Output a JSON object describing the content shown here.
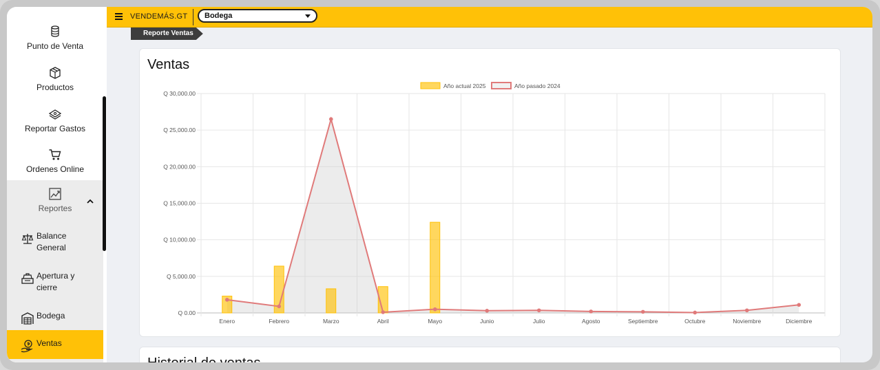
{
  "sidebar": {
    "top_items": [
      {
        "label": "Punto de Venta",
        "icon": "coins-icon"
      },
      {
        "label": "Productos",
        "icon": "box-icon"
      },
      {
        "label": "Reportar Gastos",
        "icon": "money-icon"
      },
      {
        "label": "Ordenes Online",
        "icon": "cart-icon"
      }
    ],
    "reportes_label": "Reportes",
    "sub_items": [
      {
        "label_1": "Balance",
        "label_2": "General",
        "icon": "balance-scale-icon"
      },
      {
        "label_1": "Apertura y",
        "label_2": "cierre",
        "icon": "cash-register-icon"
      },
      {
        "label_1": "Bodega",
        "label_2": "",
        "icon": "warehouse-icon"
      },
      {
        "label_1": "Ventas",
        "label_2": "",
        "icon": "hand-money-icon"
      }
    ],
    "active_color": "#ffc107"
  },
  "topbar": {
    "brand": "VENDEMÁS.GT",
    "store_selected": "Bodega"
  },
  "breadcrumb": "Reporte Ventas",
  "main": {
    "card_title": "Ventas",
    "second_card_title": "Historial de ventas"
  },
  "chart_data": {
    "type": "bar",
    "categories": [
      "Enero",
      "Febrero",
      "Marzo",
      "Abril",
      "Mayo",
      "Junio",
      "Julio",
      "Agosto",
      "Septiembre",
      "Octubre",
      "Noviembre",
      "Diciembre"
    ],
    "ylim": [
      0,
      30000
    ],
    "yticks": [
      "Q 0.00",
      "Q 5,000.00",
      "Q 10,000.00",
      "Q 15,000.00",
      "Q 20,000.00",
      "Q 25,000.00",
      "Q 30,000.00"
    ],
    "grid": true,
    "legend_position": "top",
    "series": [
      {
        "name": "Año actual 2025",
        "kind": "bar",
        "color": "#ffc107",
        "values": [
          2300,
          6400,
          3300,
          3600,
          12400,
          0,
          0,
          0,
          0,
          0,
          0,
          0
        ]
      },
      {
        "name": "Año pasado 2024",
        "kind": "line",
        "color": "#e07a7a",
        "values": [
          1800,
          900,
          26500,
          100,
          500,
          300,
          350,
          200,
          150,
          50,
          350,
          1100
        ]
      }
    ]
  }
}
